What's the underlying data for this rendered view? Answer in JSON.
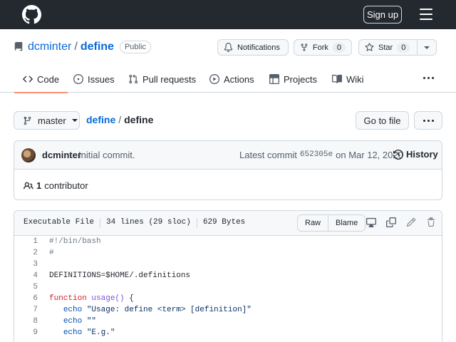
{
  "header": {
    "signup_label": "Sign up"
  },
  "repo": {
    "owner": "dcminter",
    "separator": "/",
    "name": "define",
    "visibility": "Public",
    "notifications_label": "Notifications",
    "fork_label": "Fork",
    "fork_count": "0",
    "star_label": "Star",
    "star_count": "0"
  },
  "tabs": [
    {
      "label": "Code"
    },
    {
      "label": "Issues"
    },
    {
      "label": "Pull requests"
    },
    {
      "label": "Actions"
    },
    {
      "label": "Projects"
    },
    {
      "label": "Wiki"
    }
  ],
  "branch": {
    "name": "master"
  },
  "breadcrumb": {
    "repo": "define",
    "separator": "/",
    "file": "define"
  },
  "goto_file_label": "Go to file",
  "commit": {
    "author": "dcminter",
    "message": "Initial commit.",
    "latest_label": "Latest commit",
    "sha": "652305e",
    "date_text": "on Mar 12, 2020",
    "history_label": "History"
  },
  "contributors": {
    "count": "1",
    "label": "contributor"
  },
  "file": {
    "mode": "Executable File",
    "lines": "34 lines (29 sloc)",
    "size": "629 Bytes",
    "raw_label": "Raw",
    "blame_label": "Blame"
  },
  "code_lines": [
    {
      "num": "1",
      "parts": [
        {
          "t": "#!/bin/bash",
          "c": "c-comment"
        }
      ]
    },
    {
      "num": "2",
      "parts": [
        {
          "t": "#",
          "c": "c-comment"
        }
      ]
    },
    {
      "num": "3",
      "parts": []
    },
    {
      "num": "4",
      "parts": [
        {
          "t": "DEFINITIONS=$HOME/.definitions",
          "c": ""
        }
      ]
    },
    {
      "num": "5",
      "parts": []
    },
    {
      "num": "6",
      "parts": [
        {
          "t": "function ",
          "c": "c-key"
        },
        {
          "t": "usage()",
          "c": "c-func"
        },
        {
          "t": " {",
          "c": ""
        }
      ]
    },
    {
      "num": "7",
      "parts": [
        {
          "t": "   ",
          "c": ""
        },
        {
          "t": "echo",
          "c": "c-builtin"
        },
        {
          "t": " ",
          "c": ""
        },
        {
          "t": "\"Usage: define <term> [definition]\"",
          "c": "c-str"
        }
      ]
    },
    {
      "num": "8",
      "parts": [
        {
          "t": "   ",
          "c": ""
        },
        {
          "t": "echo",
          "c": "c-builtin"
        },
        {
          "t": " ",
          "c": ""
        },
        {
          "t": "\"\"",
          "c": "c-str"
        }
      ]
    },
    {
      "num": "9",
      "parts": [
        {
          "t": "   ",
          "c": ""
        },
        {
          "t": "echo",
          "c": "c-builtin"
        },
        {
          "t": " ",
          "c": ""
        },
        {
          "t": "\"E.g.\"",
          "c": "c-str"
        }
      ]
    }
  ]
}
